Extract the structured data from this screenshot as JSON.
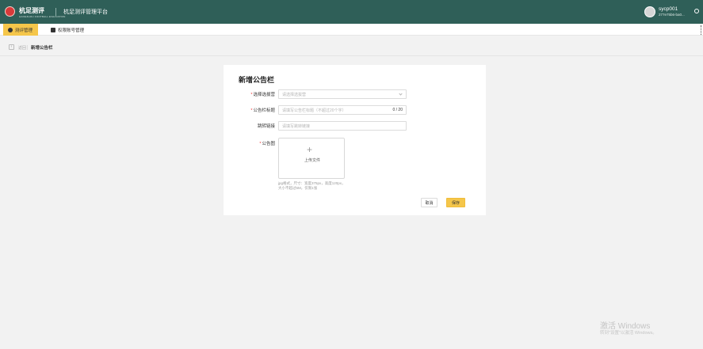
{
  "header": {
    "logo_text": "杭足测评",
    "logo_sub": "HANGZHOU FOOTBALL EVALUATION",
    "platform_title": "杭足测评管理平台",
    "user_name": "sycp001",
    "user_id": "277e75b6-ba0..."
  },
  "tabs": [
    {
      "label": "测评管理",
      "icon": "gear-icon",
      "active": true
    },
    {
      "label": "权限账号管理",
      "icon": "account-icon",
      "active": false
    }
  ],
  "breadcrumb": {
    "back_label": "返回",
    "title": "新增公告栏"
  },
  "form": {
    "title": "新增公告栏",
    "fields": {
      "venue": {
        "label": "选择选拔营",
        "required": true,
        "placeholder": "请选择选拔营"
      },
      "title": {
        "label": "公告栏标题",
        "required": true,
        "placeholder": "请填写公告栏标题（不超过20个字）",
        "counter": "0 / 20"
      },
      "link": {
        "label": "跳转链接",
        "required": false,
        "placeholder": "请填写跳转链接"
      },
      "image": {
        "label": "公告图",
        "required": true,
        "upload_label": "上传文件",
        "hint_line1": "jpg格式，尺寸：宽度375px，高度120px，",
        "hint_line2": "大小不超过5M，仅限1张"
      }
    },
    "cancel_label": "取消",
    "save_label": "保存"
  },
  "watermark": {
    "title": "激活 Windows",
    "subtitle": "转到\"设置\"以激活 Windows。"
  }
}
